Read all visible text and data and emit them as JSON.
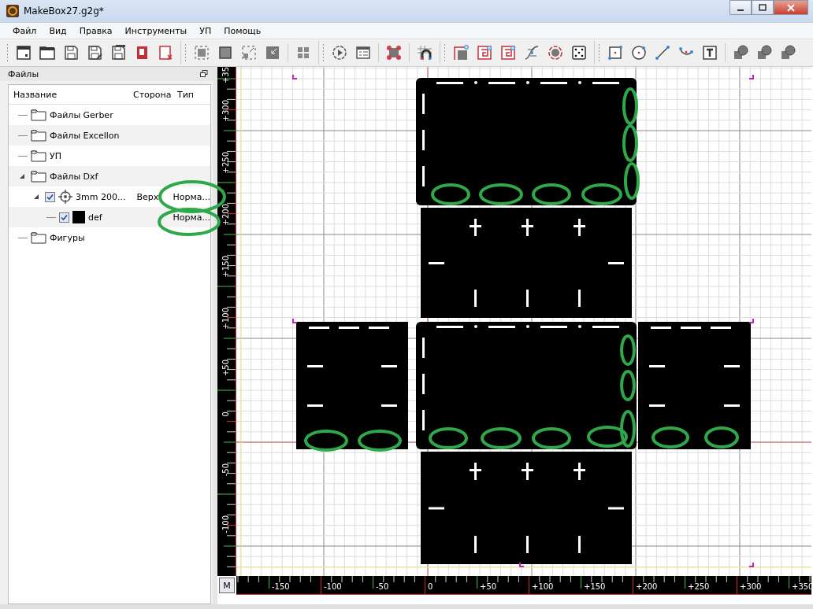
{
  "window": {
    "title": "MakeBox27.g2g*"
  },
  "menu": [
    "Файл",
    "Вид",
    "Правка",
    "Инструменты",
    "УП",
    "Помощь"
  ],
  "files_panel": {
    "title": "Файлы",
    "columns": [
      "Название",
      "Сторона",
      "Тип"
    ],
    "tree": [
      {
        "name": "Файлы Gerber",
        "kind": "folder"
      },
      {
        "name": "Файлы Excellon",
        "kind": "folder"
      },
      {
        "name": "УП",
        "kind": "folder"
      },
      {
        "name": "Файлы Dxf",
        "kind": "folder",
        "expanded": true,
        "children": [
          {
            "name": "3mm 200...",
            "kind": "file",
            "side": "Верх",
            "type": "Норма...",
            "checked": true,
            "expanded": true,
            "children": [
              {
                "name": "def",
                "kind": "layer",
                "type": "Норма...",
                "checked": true,
                "color": "#000000"
              }
            ]
          }
        ]
      },
      {
        "name": "Фигуры",
        "kind": "folder"
      }
    ]
  },
  "rulers": {
    "vertical_labels": [
      "+35",
      "+300",
      "+250",
      "+200",
      "+150",
      "+100",
      "+50",
      "0",
      "-50",
      "-100"
    ],
    "horizontal_labels": [
      "-150",
      "-100",
      "-50",
      "0",
      "+50",
      "+100",
      "+150",
      "+200",
      "+250",
      "+300",
      "+350"
    ],
    "corner_button": "M"
  }
}
